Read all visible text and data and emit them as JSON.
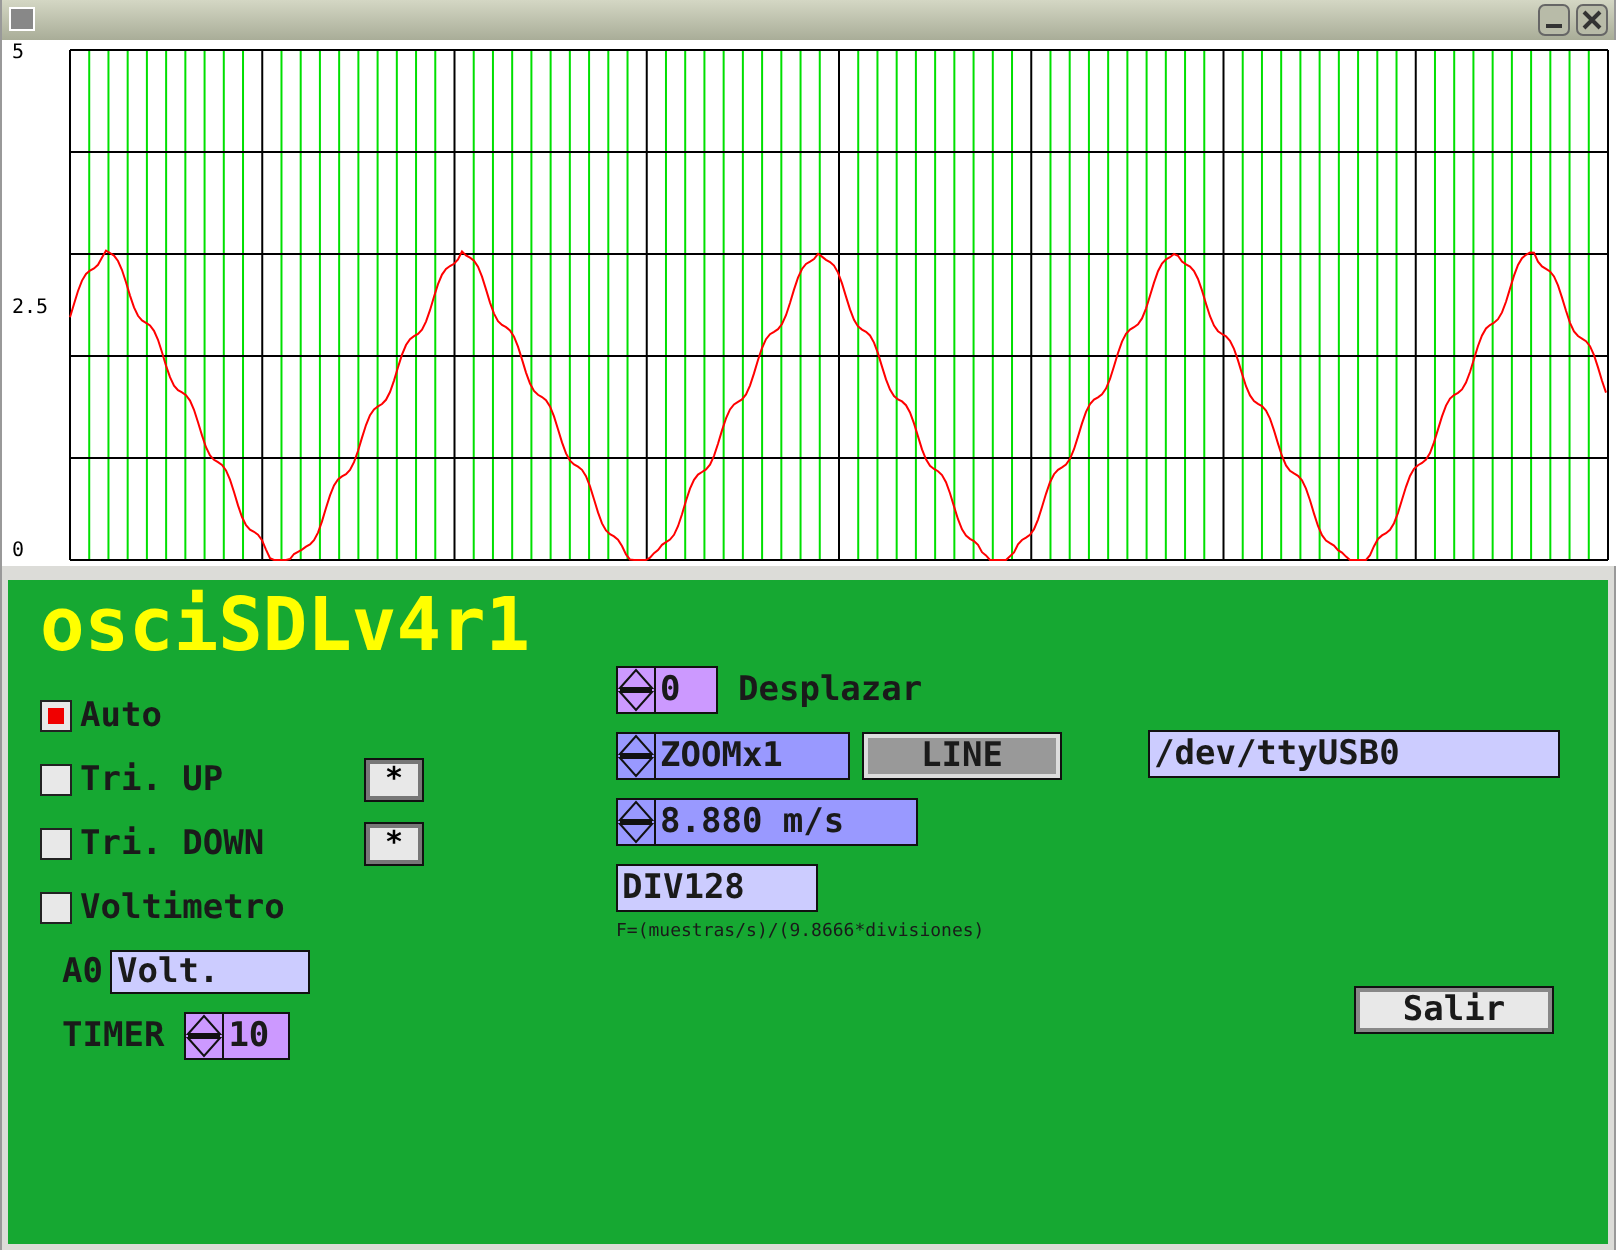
{
  "plot": {
    "y_labels": [
      "5",
      "2.5",
      "0"
    ]
  },
  "app_title": "osciSDLv4r1",
  "checkboxes": [
    {
      "label": "Auto",
      "checked": true
    },
    {
      "label": "Tri. UP",
      "checked": false,
      "button": "*"
    },
    {
      "label": "Tri. DOWN",
      "checked": false,
      "button": "*"
    },
    {
      "label": "Voltimetro",
      "checked": false
    }
  ],
  "a0": {
    "label": "A0",
    "value": "Volt."
  },
  "timer": {
    "label": "TIMER",
    "value": "10"
  },
  "offset": {
    "value": "0",
    "label": "Desplazar"
  },
  "zoom": {
    "value": "ZOOMx1"
  },
  "line_button": "LINE",
  "port": "/dev/ttyUSB0",
  "speed": {
    "value": "8.880 m/s"
  },
  "divisions": "DIV128",
  "formula": "F=(muestras/s)/(9.8666*divisiones)",
  "exit_button": "Salir"
}
